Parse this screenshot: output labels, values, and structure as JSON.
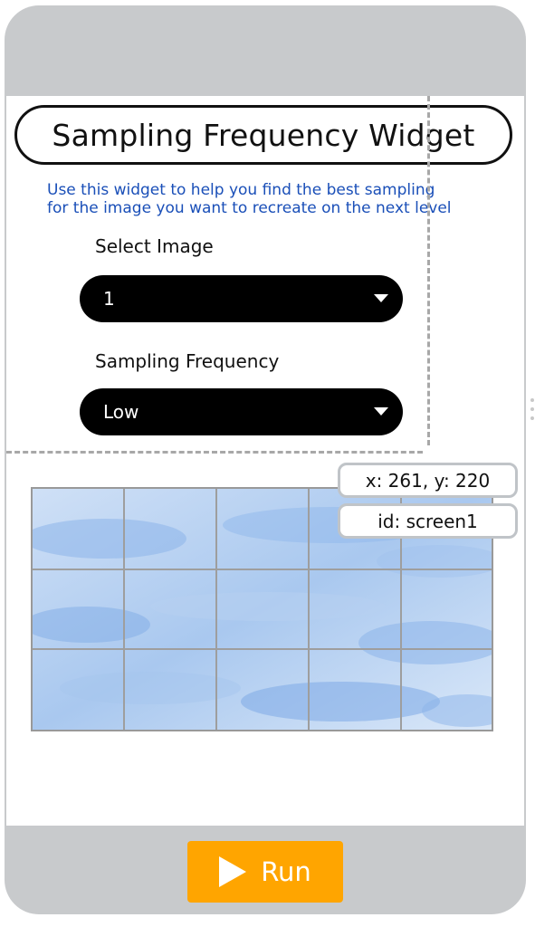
{
  "widget": {
    "title": "Sampling Frequency Widget",
    "instructions_line1": "Use this widget to help you find the best sampling",
    "instructions_line2": "for the image you want to recreate on the next level"
  },
  "image_select": {
    "label": "Select Image",
    "selected": "1"
  },
  "frequency_select": {
    "label": "Sampling Frequency",
    "selected": "Low"
  },
  "preview": {
    "grid_columns": 5,
    "grid_rows": 3
  },
  "tooltip": {
    "coords": "x: 261, y: 220",
    "id": "id: screen1"
  },
  "run_button": {
    "label": "Run"
  },
  "colors": {
    "accent": "#ffa500",
    "instructions_text": "#1a4fb8",
    "dropdown_bg": "#000000",
    "device_frame": "#c8cacc"
  }
}
